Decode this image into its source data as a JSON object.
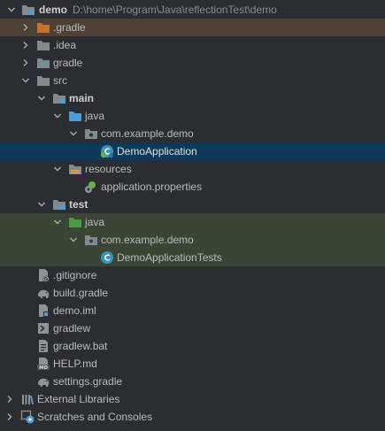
{
  "root": {
    "name": "demo",
    "path": "D:\\home\\Program\\Java\\reflectionTest\\demo"
  },
  "items": [
    {
      "label": "demo"
    },
    {
      "label": ".gradle"
    },
    {
      "label": ".idea"
    },
    {
      "label": "gradle"
    },
    {
      "label": "src"
    },
    {
      "label": "main"
    },
    {
      "label": "java"
    },
    {
      "label": "com.example.demo"
    },
    {
      "label": "DemoApplication"
    },
    {
      "label": "resources"
    },
    {
      "label": "application.properties"
    },
    {
      "label": "test"
    },
    {
      "label": "java"
    },
    {
      "label": "com.example.demo"
    },
    {
      "label": "DemoApplicationTests"
    },
    {
      "label": ".gitignore"
    },
    {
      "label": "build.gradle"
    },
    {
      "label": "demo.iml"
    },
    {
      "label": "gradlew"
    },
    {
      "label": "gradlew.bat"
    },
    {
      "label": "HELP.md"
    },
    {
      "label": "settings.gradle"
    },
    {
      "label": "External Libraries"
    },
    {
      "label": "Scratches and Consoles"
    }
  ],
  "colors": {
    "background": "#2b2d30",
    "selection": "#0d3a58",
    "excluded": "#4d4034",
    "test_root": "#3a4536",
    "folder": "#7f8b91",
    "source_folder": "#4e9ed5",
    "test_folder": "#4d9a45",
    "excluded_folder": "#c8702d"
  }
}
